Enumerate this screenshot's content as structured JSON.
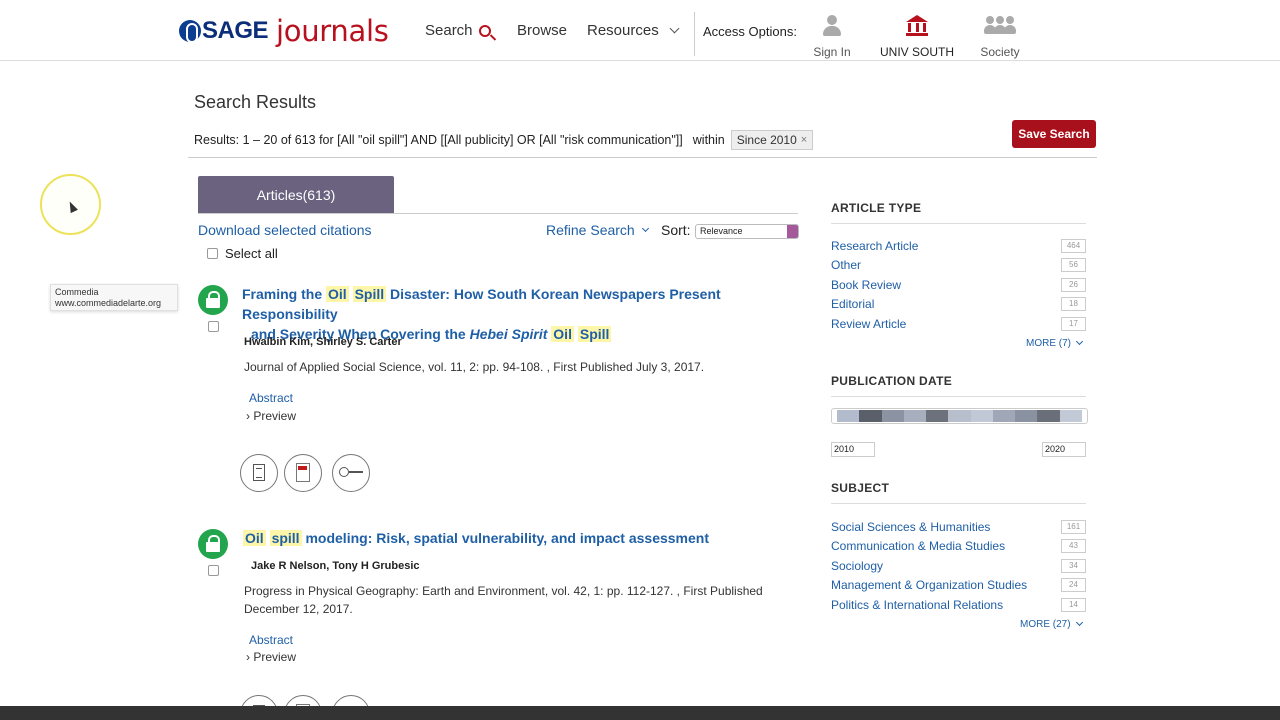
{
  "header": {
    "logo_sage": "SAGE",
    "logo_journals": "journals",
    "nav": {
      "search": "Search",
      "browse": "Browse",
      "resources": "Resources"
    },
    "access_label": "Access Options:",
    "access_options": {
      "sign_in": "Sign In",
      "institution": "UNIV SOUTH",
      "society": "Society"
    }
  },
  "results": {
    "title": "Search Results",
    "summary": "Results: 1 – 20 of 613 for [All \"oil spill\"] AND [[All publicity] OR [All \"risk communication\"]]",
    "within": "within",
    "filter_chip": "Since 2010",
    "chip_remove": "×",
    "save_search": "Save Search"
  },
  "tab": {
    "articles": "Articles(613)"
  },
  "toolbar": {
    "download": "Download selected citations",
    "refine": "Refine Search",
    "sort_label": "Sort:",
    "sort_value": "Relevance",
    "select_all": "Select all"
  },
  "tooltip": {
    "line1": "Commedia",
    "line2": "www.commediadelarte.org"
  },
  "articles": [
    {
      "title_parts": [
        "Framing the ",
        "Oil",
        " ",
        "Spill",
        " Disaster: How South Korean Newspapers Present Responsibility",
        "and Severity When Covering the ",
        "Hebei Spirit",
        " ",
        "Oil",
        " ",
        "Spill"
      ],
      "author1": "Hwalbin Kim",
      "author2": "Shirley S. Carter",
      "citation": "Journal of Applied Social Science, vol. 11, 2: pp. 94-108. , First Published July 3, 2017.",
      "abstract": "Abstract",
      "preview": "Preview"
    },
    {
      "title_parts": [
        "Oil",
        " ",
        "spill",
        " modeling: Risk, spatial vulnerability, and impact assessment"
      ],
      "author1": "Jake R Nelson",
      "author2": "Tony H Grubesic",
      "citation": "Progress in Physical Geography: Earth and Environment, vol. 42, 1: pp. 112-127. , First Published December 12, 2017.",
      "abstract": "Abstract",
      "preview": "Preview"
    }
  ],
  "sidebar": {
    "article_type": {
      "title": "ARTICLE TYPE",
      "items": [
        {
          "label": "Research Article",
          "count": "464"
        },
        {
          "label": "Other",
          "count": "56"
        },
        {
          "label": "Book Review",
          "count": "26"
        },
        {
          "label": "Editorial",
          "count": "18"
        },
        {
          "label": "Review Article",
          "count": "17"
        }
      ],
      "more": "MORE (7)"
    },
    "publication_date": {
      "title": "PUBLICATION DATE",
      "from": "2010",
      "to": "2020"
    },
    "subject": {
      "title": "SUBJECT",
      "items": [
        {
          "label": "Social Sciences & Humanities",
          "count": "161"
        },
        {
          "label": "Communication & Media Studies",
          "count": "43"
        },
        {
          "label": "Sociology",
          "count": "34"
        },
        {
          "label": "Management & Organization Studies",
          "count": "24"
        },
        {
          "label": "Politics & International Relations",
          "count": "14"
        }
      ],
      "more": "MORE (27)"
    }
  },
  "colors": {
    "brand_red": "#a8101c",
    "link_blue": "#1f5fa6",
    "tab_purple": "#6b6280",
    "access_green": "#23a54d",
    "highlight": "#fdf6a8"
  }
}
